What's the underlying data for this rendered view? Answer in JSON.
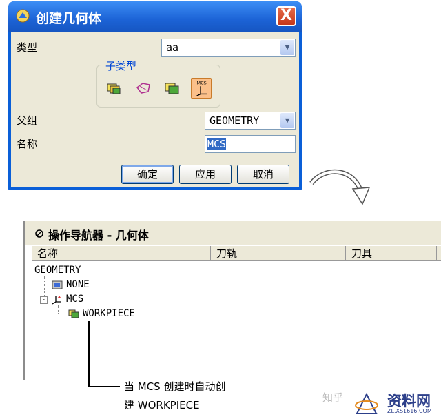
{
  "dialog": {
    "title": "创建几何体",
    "close_label": "X",
    "type_label": "类型",
    "type_value": "aa",
    "subtype_label": "子类型",
    "subtype_icons": [
      "mill-geom-icon",
      "mill-boundary-icon",
      "workpiece-icon",
      "mcs-icon"
    ],
    "mcs_icon_caption": "MCS",
    "parent_label": "父组",
    "parent_value": "GEOMETRY",
    "name_label": "名称",
    "name_value": "MCS",
    "ok_label": "确定",
    "apply_label": "应用",
    "cancel_label": "取消"
  },
  "navigator": {
    "title": "操作导航器 - 几何体",
    "columns": [
      "名称",
      "刀轨",
      "刀具"
    ],
    "tree": [
      {
        "label": "GEOMETRY",
        "level": 0
      },
      {
        "label": "NONE",
        "level": 1
      },
      {
        "label": "MCS",
        "level": 1,
        "expander": "-"
      },
      {
        "label": "WORKPIECE",
        "level": 2
      }
    ]
  },
  "callout": {
    "line1": "当 MCS 创建时自动创",
    "line2": "建 WORKPIECE"
  },
  "watermark": {
    "zhihu": "知乎",
    "brand": "资料网",
    "url": "ZL.XS1616.COM"
  },
  "colors": {
    "title_blue": "#1c63d6",
    "dialog_bg": "#ece9d8",
    "selection": "#316ac5",
    "subtype_label": "#0046d5"
  }
}
